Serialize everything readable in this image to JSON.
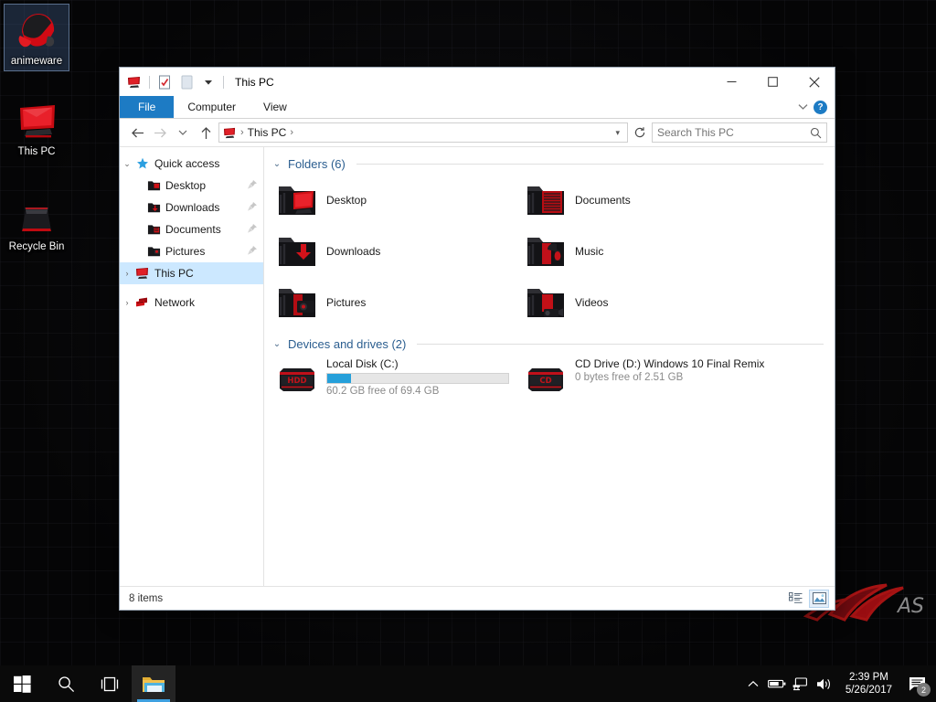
{
  "desktop": {
    "icons": [
      {
        "label": "animeware",
        "icon": "headset-icon",
        "selected": true
      },
      {
        "label": "This PC",
        "icon": "monitor-icon",
        "selected": false
      },
      {
        "label": "Recycle Bin",
        "icon": "recycle-bin-icon",
        "selected": false
      }
    ],
    "watermark": "rog-logo"
  },
  "window": {
    "title": "This PC",
    "quick_access_toolbar": [
      {
        "name": "this-pc-icon",
        "icon": "monitor-icon"
      },
      {
        "name": "properties-icon",
        "icon": "document-check-icon"
      },
      {
        "name": "new-folder-icon",
        "icon": "page-icon"
      },
      {
        "name": "customize-qat-icon",
        "icon": "chevron-down-icon"
      }
    ],
    "controls": {
      "minimize": "—",
      "maximize": "☐",
      "close": "✕"
    },
    "ribbon": {
      "tabs": [
        {
          "label": "File",
          "active": true
        },
        {
          "label": "Computer",
          "active": false
        },
        {
          "label": "View",
          "active": false
        }
      ],
      "collapse_icon": "chevron-down-icon",
      "help_label": "?"
    },
    "address": {
      "back_icon": "arrow-left-icon",
      "forward_icon": "arrow-right-icon",
      "recent_icon": "chevron-down-icon",
      "up_icon": "arrow-up-icon",
      "crumbs": [
        "This PC"
      ],
      "separator": "›",
      "dropdown_icon": "chevron-down-icon",
      "refresh_icon": "refresh-icon"
    },
    "search": {
      "placeholder": "Search This PC",
      "value": "",
      "icon": "search-icon"
    }
  },
  "sidebar": {
    "items": [
      {
        "label": "Quick access",
        "icon": "star-icon",
        "expander": "⌄",
        "level": 0,
        "selected": false,
        "pinned": false
      },
      {
        "label": "Desktop",
        "icon": "folder-desktop-icon",
        "level": 1,
        "selected": false,
        "pinned": true
      },
      {
        "label": "Downloads",
        "icon": "folder-downloads-icon",
        "level": 1,
        "selected": false,
        "pinned": true
      },
      {
        "label": "Documents",
        "icon": "folder-documents-icon",
        "level": 1,
        "selected": false,
        "pinned": true
      },
      {
        "label": "Pictures",
        "icon": "folder-pictures-icon",
        "level": 1,
        "selected": false,
        "pinned": true
      },
      {
        "label": "This PC",
        "icon": "monitor-icon",
        "expander": "›",
        "level": 0,
        "selected": true,
        "pinned": false
      },
      {
        "label": "Network",
        "icon": "network-icon",
        "expander": "›",
        "level": 0,
        "selected": false,
        "pinned": false
      }
    ]
  },
  "content": {
    "groups": [
      {
        "title": "Folders (6)",
        "chevron": "⌄",
        "type": "folders",
        "items": [
          {
            "name": "Desktop",
            "icon": "folder-desktop-icon"
          },
          {
            "name": "Documents",
            "icon": "folder-documents-icon"
          },
          {
            "name": "Downloads",
            "icon": "folder-downloads-icon"
          },
          {
            "name": "Music",
            "icon": "folder-music-icon"
          },
          {
            "name": "Pictures",
            "icon": "folder-pictures-icon"
          },
          {
            "name": "Videos",
            "icon": "folder-videos-icon"
          }
        ]
      },
      {
        "title": "Devices and drives (2)",
        "chevron": "⌄",
        "type": "drives",
        "items": [
          {
            "name": "Local Disk (C:)",
            "icon": "hdd-icon",
            "icon_label": "HDD",
            "free_text": "60.2 GB free of 69.4 GB",
            "used_percent": 13,
            "bar_color": "#26a0da",
            "show_bar": true
          },
          {
            "name": "CD Drive (D:) Windows 10 Final Remix",
            "icon": "cd-icon",
            "icon_label": "CD",
            "free_text": "0 bytes free of 2.51 GB",
            "used_percent": 100,
            "bar_color": "#26a0da",
            "show_bar": false
          }
        ]
      }
    ]
  },
  "statusbar": {
    "item_count": "8 items",
    "views": [
      {
        "name": "details-view-button",
        "icon": "list-icon",
        "active": false
      },
      {
        "name": "large-icons-view-button",
        "icon": "thumbnail-icon",
        "active": true
      }
    ]
  },
  "taskbar": {
    "buttons": [
      {
        "name": "start-button",
        "icon": "windows-logo-icon"
      },
      {
        "name": "search-button",
        "icon": "search-icon"
      },
      {
        "name": "task-view-button",
        "icon": "task-view-icon"
      },
      {
        "name": "file-explorer-button",
        "icon": "folder-icon",
        "active": true
      }
    ],
    "tray": [
      {
        "name": "show-hidden-icons",
        "icon": "chevron-up-icon"
      },
      {
        "name": "battery-icon",
        "icon": "battery-icon"
      },
      {
        "name": "network-icon",
        "icon": "network-icon"
      },
      {
        "name": "volume-icon",
        "icon": "speaker-icon"
      }
    ],
    "clock": {
      "time": "2:39 PM",
      "date": "5/26/2017"
    },
    "notifications": {
      "icon": "action-center-icon",
      "badge": "2"
    }
  },
  "colors": {
    "accent": "#1d7bc4",
    "selection": "#cce8ff",
    "group_header": "#2a5d8f",
    "progress": "#26a0da",
    "taskbar": "#0a0a0a",
    "theme_red": "#c80000"
  }
}
